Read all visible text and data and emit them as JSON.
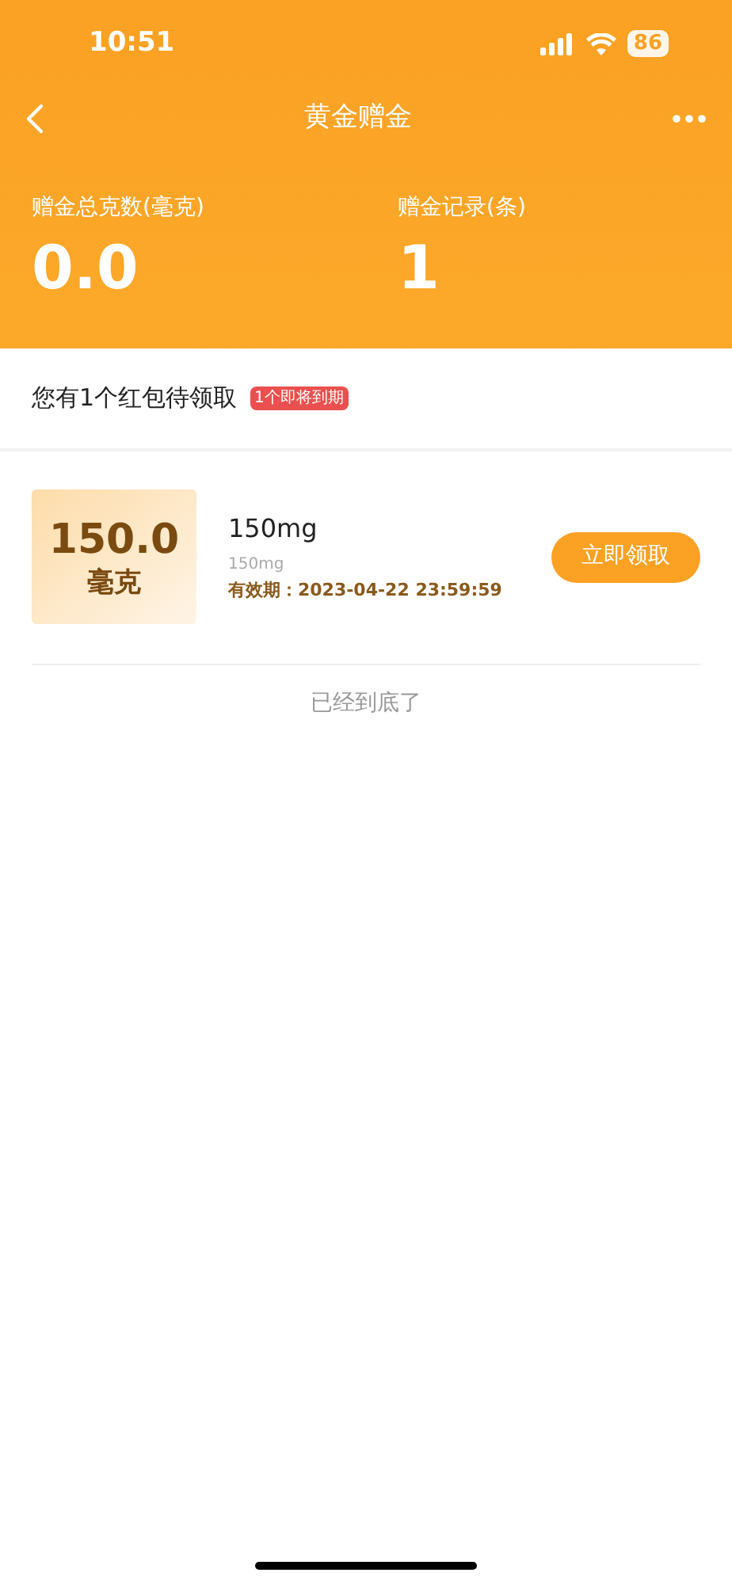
{
  "status_bar": {
    "time": "10:51",
    "battery": "86"
  },
  "nav": {
    "title": "黄金赠金"
  },
  "stats": [
    {
      "label": "赠金总克数(毫克)",
      "value": "0.0"
    },
    {
      "label": "赠金记录(条)",
      "value": "1"
    }
  ],
  "notice": {
    "text": "您有1个红包待领取",
    "badge": "1个即将到期"
  },
  "items": [
    {
      "amount": "150.0",
      "unit": "毫克",
      "title": "150mg",
      "subtitle": "150mg",
      "validity": "有效期：2023-04-22 23:59:59",
      "button": "立即领取"
    }
  ],
  "footer": "已经到底了"
}
